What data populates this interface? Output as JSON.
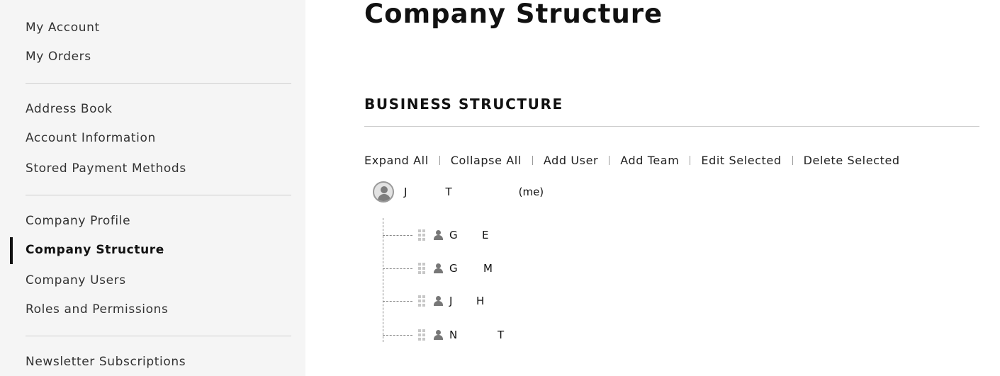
{
  "sidebar": {
    "items": [
      {
        "label": "My Account"
      },
      {
        "label": "My Orders"
      },
      {
        "label": "Address Book"
      },
      {
        "label": "Account Information"
      },
      {
        "label": "Stored Payment Methods"
      },
      {
        "label": "Company Profile"
      },
      {
        "label": "Company Structure",
        "current": true
      },
      {
        "label": "Company Users"
      },
      {
        "label": "Roles and Permissions"
      },
      {
        "label": "Newsletter Subscriptions"
      }
    ]
  },
  "page": {
    "title": "Company Structure",
    "section_title": "BUSINESS STRUCTURE"
  },
  "actions": [
    {
      "label": "Expand All"
    },
    {
      "label": "Collapse All"
    },
    {
      "label": "Add User"
    },
    {
      "label": "Add Team"
    },
    {
      "label": "Edit Selected"
    },
    {
      "label": "Delete Selected"
    }
  ],
  "tree": {
    "root": {
      "first": "J",
      "last": "T",
      "suffix": "(me)",
      "icon": "avatar-icon"
    },
    "children": [
      {
        "first": "G",
        "last": "E",
        "icon": "user-icon"
      },
      {
        "first": "G",
        "last": "M",
        "icon": "user-icon"
      },
      {
        "first": "J",
        "last": "H",
        "icon": "user-icon"
      },
      {
        "first": "N",
        "last": "T",
        "icon": "user-icon"
      }
    ]
  }
}
